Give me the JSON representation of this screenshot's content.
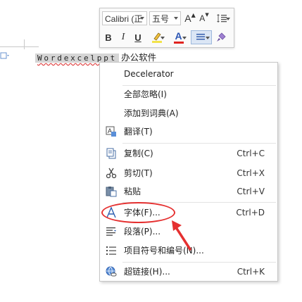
{
  "document": {
    "selected_text": "Wordexcelppt",
    "following_text": "办公软件"
  },
  "toolbar": {
    "font_family": "Calibri (正",
    "font_size": "五号",
    "grow_font_label": "A",
    "shrink_font_label": "A",
    "bold_label": "B",
    "italic_label": "I",
    "underline_label": "U",
    "font_color_label": "A"
  },
  "menu": {
    "items": [
      {
        "label": "Decelerator",
        "shortcut": ""
      },
      {
        "label": "全部忽略(I)",
        "shortcut": ""
      },
      {
        "label": "添加到词典(A)",
        "shortcut": ""
      },
      {
        "label": "翻译(T)",
        "shortcut": ""
      },
      {
        "label": "复制(C)",
        "shortcut": "Ctrl+C"
      },
      {
        "label": "剪切(T)",
        "shortcut": "Ctrl+X"
      },
      {
        "label": "粘贴",
        "shortcut": "Ctrl+V"
      },
      {
        "label": "字体(F)...",
        "shortcut": "Ctrl+D"
      },
      {
        "label": "段落(P)...",
        "shortcut": ""
      },
      {
        "label": "项目符号和编号(N)...",
        "shortcut": ""
      },
      {
        "label": "超链接(H)...",
        "shortcut": "Ctrl+K"
      }
    ]
  },
  "colors": {
    "annotation": "#e53030",
    "highlight_bar": "#f2e34a",
    "font_color_bar": "#e0241f",
    "selection": "#d5d5d5"
  }
}
